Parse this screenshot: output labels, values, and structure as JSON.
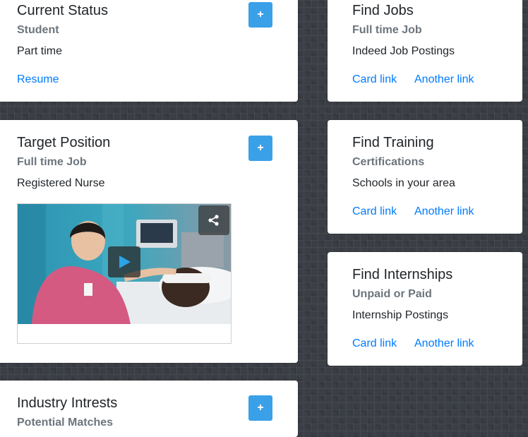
{
  "cards": {
    "current_status": {
      "title": "Current Status",
      "subtitle": "Student",
      "text": "Part time",
      "link": "Resume",
      "button": "+"
    },
    "target_position": {
      "title": "Target Position",
      "subtitle": "Full time Job",
      "text": "Registered Nurse",
      "button": "+"
    },
    "industry_interests": {
      "title": "Industry Intrests",
      "subtitle": "Potential Matches",
      "button": "+"
    },
    "find_jobs": {
      "title": "Find Jobs",
      "subtitle": "Full time Job",
      "text": "Indeed Job Postings",
      "link1": "Card link",
      "link2": "Another link"
    },
    "find_training": {
      "title": "Find Training",
      "subtitle": "Certifications",
      "text": "Schools in your area",
      "link1": "Card link",
      "link2": "Another link"
    },
    "find_internships": {
      "title": "Find Internships",
      "subtitle": "Unpaid or Paid",
      "text": "Internship Postings",
      "link1": "Card link",
      "link2": "Another link"
    }
  },
  "video": {
    "play_icon": "play-icon",
    "share_icon": "share-icon"
  },
  "colors": {
    "accent": "#3aa0e8",
    "link": "#007bff",
    "background": "#3b3f45"
  }
}
